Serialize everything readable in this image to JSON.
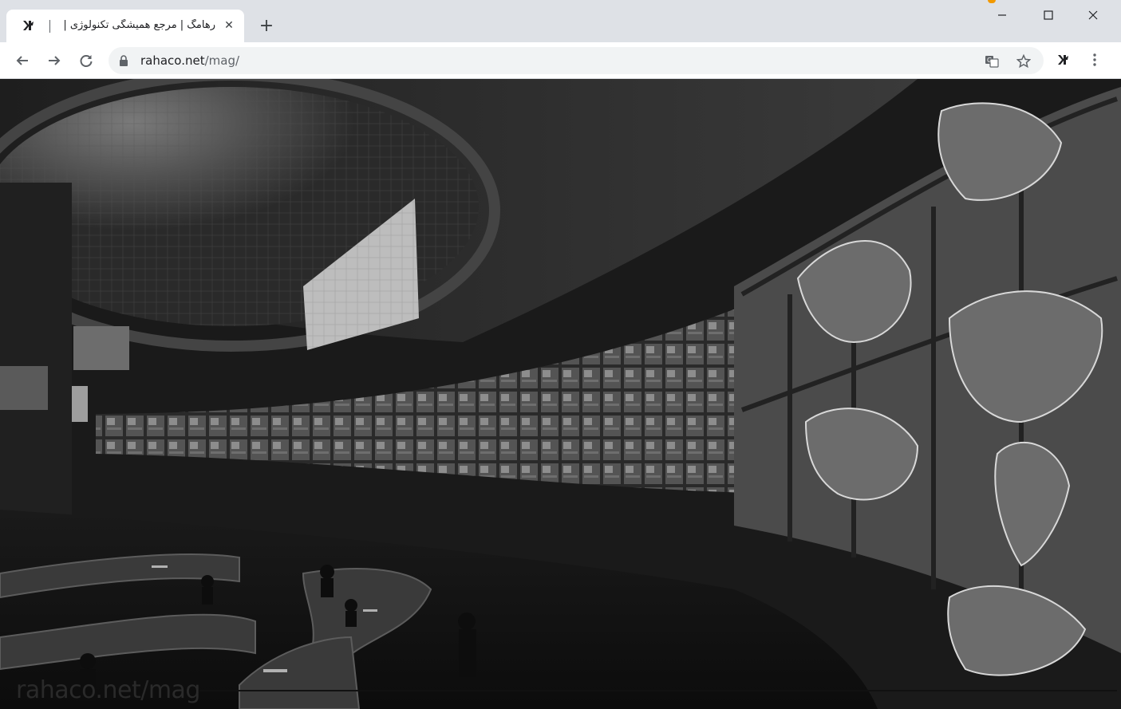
{
  "browser": {
    "tab": {
      "title": "رهامگ | مرجع همیشگی تکنولوژی |",
      "close_label": "✕",
      "favicon": "rahaco-logo-icon"
    },
    "new_tab_label": "+",
    "window_controls": {
      "minimize": "minimize-icon",
      "maximize": "maximize-icon",
      "close": "close-icon"
    },
    "toolbar": {
      "back": "back-arrow-icon",
      "forward": "forward-arrow-icon",
      "reload": "reload-icon",
      "url_host": "rahaco.net",
      "url_path": "/mag/",
      "translate": "translate-icon",
      "bookmark": "star-icon",
      "extension": "rahaco-extension-icon",
      "menu": "kebab-menu-icon"
    }
  },
  "page": {
    "hero_image": "network-operations-center-photo",
    "watermark": "rahaco.net/mag"
  },
  "colors": {
    "tabstrip_bg": "#dee1e6",
    "omnibox_bg": "#f1f3f4",
    "accent_dot": "#f29900"
  }
}
